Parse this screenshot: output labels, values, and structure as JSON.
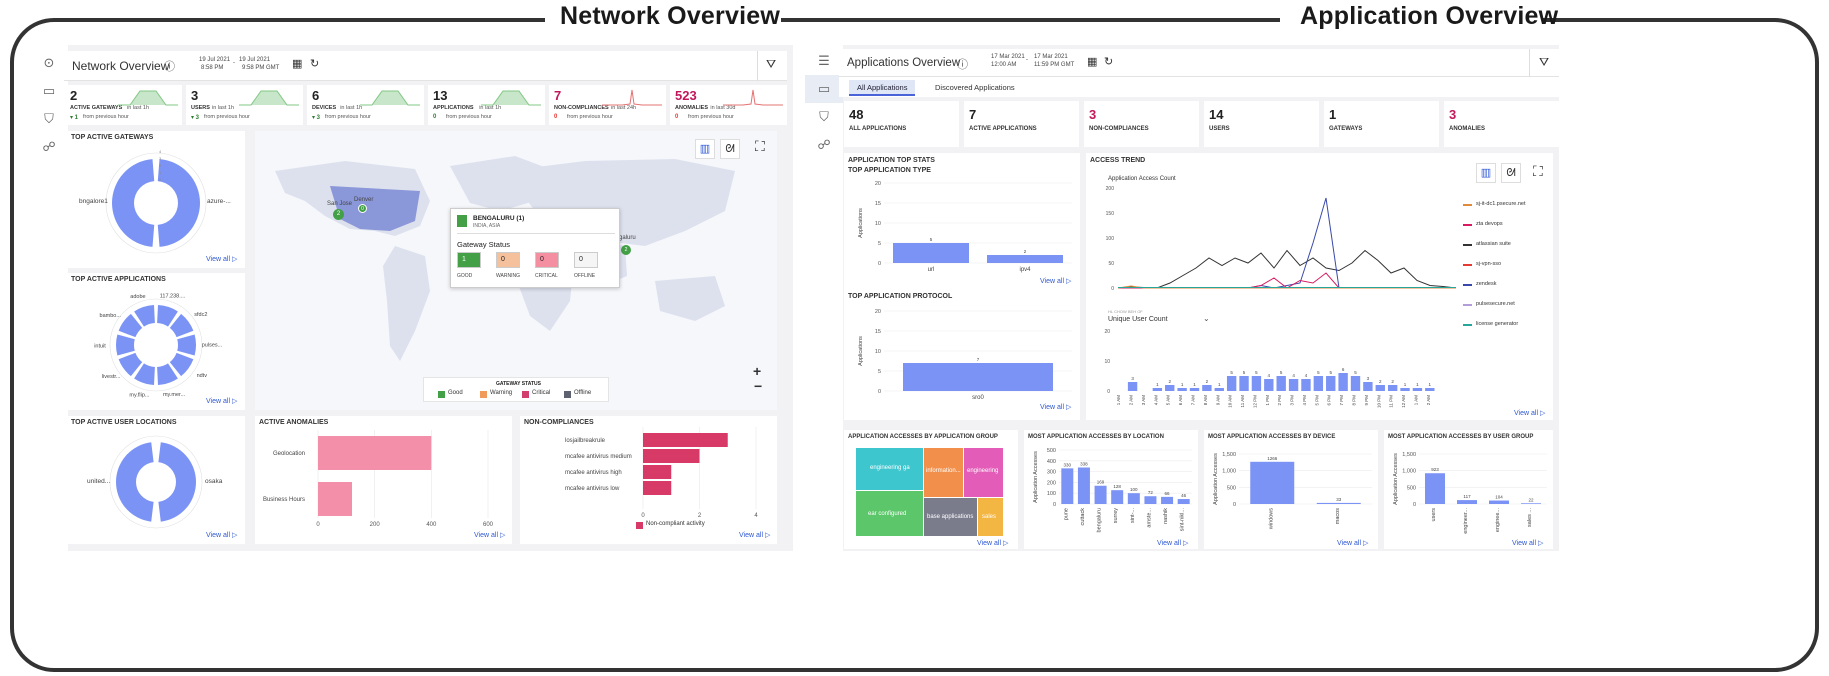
{
  "headers": {
    "network": "Network Overview",
    "application": "Application Overview"
  },
  "network": {
    "title": "Network Overview",
    "info_icon": "info-icon",
    "date_from": "19 Jul 2021",
    "time_from": "8:58 PM",
    "date_sep": "-",
    "date_to": "19 Jul 2021",
    "time_to": "9:58 PM GMT",
    "stats": [
      {
        "value": "2",
        "label": "ACTIVE GATEWAYS",
        "sub": "in last 1h",
        "delta": "▾ 1",
        "from": "from previous hour",
        "color": "#4caf50"
      },
      {
        "value": "3",
        "label": "USERS",
        "sub": "in last 1h",
        "delta": "▾ 3",
        "from": "from previous hour",
        "color": "#4caf50"
      },
      {
        "value": "6",
        "label": "DEVICES",
        "sub": "in last 1h",
        "delta": "▾ 3",
        "from": "from previous hour",
        "color": "#4caf50"
      },
      {
        "value": "13",
        "label": "APPLICATIONS",
        "sub": "in last 1h",
        "delta": "0",
        "from": "from previous hour",
        "color": "#4caf50"
      },
      {
        "value": "7",
        "label": "NON-COMPLIANCES",
        "sub": "in last 24h",
        "delta": "0",
        "from": "from previous hour",
        "color": "#e57373"
      },
      {
        "value": "523",
        "label": "ANOMALIES",
        "sub": "in last 30d",
        "delta": "0",
        "from": "from previous hour",
        "color": "#e57373"
      }
    ],
    "gateways": {
      "title": "TOP ACTIVE GATEWAYS",
      "labels": [
        "bngalore1",
        "azure-..."
      ],
      "ticks": [
        "4",
        "3",
        "2",
        "1",
        "0"
      ],
      "view_all": "View all ▷"
    },
    "apps": {
      "title": "TOP ACTIVE APPLICATIONS",
      "labels": [
        "117.238....",
        "sfdc2",
        "pulses...",
        "ndtv",
        "my.mer...",
        "my.flip...",
        "livestr...",
        "intuit",
        "bambo...",
        "adobe"
      ],
      "view_all": "View all ▷"
    },
    "locations": {
      "title": "TOP ACTIVE USER LOCATIONS",
      "labels": [
        "united...",
        "osaka"
      ],
      "view_all": "View all ▷"
    },
    "map": {
      "cities": [
        {
          "name": "San Jose",
          "count": "2"
        },
        {
          "name": "Denver",
          "count": "0"
        },
        {
          "name": "galuru",
          "count": "2"
        }
      ],
      "popup": {
        "title": "BENGALURU (1)",
        "region": "INDIA, ASIA",
        "status_title": "Gateway Status",
        "cells": [
          {
            "value": "1",
            "label": "GOOD"
          },
          {
            "value": "0",
            "label": "WARNING"
          },
          {
            "value": "0",
            "label": "CRITICAL"
          },
          {
            "value": "0",
            "label": "OFFLINE"
          }
        ]
      },
      "legend_title": "GATEWAY STATUS",
      "legend": [
        "Good",
        "Warning",
        "Critical",
        "Offline"
      ],
      "zoom_in": "+",
      "zoom_out": "−"
    },
    "anomalies": {
      "title": "ACTIVE ANOMALIES",
      "categories": [
        "Geolocation",
        "Business Hours"
      ],
      "values": [
        400,
        120
      ],
      "ticks": [
        "0",
        "200",
        "400",
        "600"
      ],
      "view_all": "View all ▷"
    },
    "noncomp": {
      "title": "NON-COMPLIANCES",
      "categories": [
        "losjailbreakrule",
        "mcafee antivirus medium",
        "mcafee antivirus high",
        "mcafee antivirus low"
      ],
      "values": [
        3,
        2,
        1,
        1
      ],
      "ticks": [
        "0",
        "2",
        "4"
      ],
      "legend": "Non-compliant activity",
      "view_all": "View all ▷"
    }
  },
  "application": {
    "title": "Applications Overview",
    "date_from": "17 Mar 2021",
    "time_from": "12:00 AM",
    "date_sep": "-",
    "date_to": "17 Mar 2021",
    "time_to": "11:59 PM GMT",
    "tabs": [
      "All Applications",
      "Discovered Applications"
    ],
    "stats": [
      {
        "value": "48",
        "label": "ALL APPLICATIONS",
        "red": false
      },
      {
        "value": "7",
        "label": "ACTIVE APPLICATIONS",
        "red": false
      },
      {
        "value": "3",
        "label": "NON-COMPLIANCES",
        "red": true
      },
      {
        "value": "14",
        "label": "USERS",
        "red": false
      },
      {
        "value": "1",
        "label": "GATEWAYS",
        "red": false
      },
      {
        "value": "3",
        "label": "ANOMALIES",
        "red": true
      }
    ],
    "topstats": {
      "title": "APPLICATION TOP STATS",
      "type_title": "TOP APPLICATION TYPE",
      "type_ylabel": "Applications",
      "type_cats": [
        "url",
        "ipv4"
      ],
      "type_vals": [
        5,
        2
      ],
      "type_ticks": [
        "20",
        "15",
        "10",
        "5",
        "0"
      ],
      "proto_title": "TOP APPLICATION PROTOCOL",
      "proto_ylabel": "Applications",
      "proto_cats": [
        "sro0"
      ],
      "proto_vals": [
        7
      ],
      "proto_ticks": [
        "20",
        "15",
        "10",
        "5",
        "0"
      ],
      "view_all": "View all ▷"
    },
    "access": {
      "title": "ACCESS TREND",
      "chart_title": "Application Access Count",
      "ticks": [
        "200",
        "150",
        "100",
        "50",
        "0"
      ],
      "legend": [
        "sj-it-dc1.psecure.net",
        "zta devops",
        "atlassian suite",
        "sj-vpn-sso",
        "zendesk",
        "pulsesecure.net",
        "license generator"
      ],
      "legend_colors": [
        "#e08a3c",
        "#d81b60",
        "#333333",
        "#e53935",
        "#3949ab",
        "#b39ddb",
        "#26a69a"
      ],
      "ucc_label": "Unique User Count",
      "ucc_small": "HL CHOW BEH OF",
      "bar_vals": [
        0,
        3,
        0,
        1,
        2,
        1,
        1,
        2,
        1,
        5,
        5,
        5,
        4,
        5,
        4,
        4,
        5,
        5,
        6,
        5,
        3,
        2,
        2,
        1,
        1,
        1
      ],
      "bar_ticks": [
        "20",
        "10",
        "0"
      ],
      "bar_labels": [
        "1 AM",
        "2 AM",
        "3 AM",
        "4 AM",
        "5 AM",
        "6 AM",
        "7 AM",
        "8 AM",
        "9 AM",
        "10 AM",
        "11 AM",
        "12 PM",
        "1 PM",
        "2 PM",
        "3 PM",
        "4 PM",
        "5 PM",
        "6 PM",
        "7 PM",
        "8 PM",
        "9 PM",
        "10 PM",
        "11 PM",
        "12 AM",
        "1 AM",
        "2 AM"
      ],
      "view_all": "View all ▷"
    },
    "group": {
      "title": "APPLICATION ACCESSES BY APPLICATION GROUP",
      "tiles": [
        "engineering ga",
        "information...",
        "engineering",
        "ear configured",
        "base applications",
        "sales"
      ],
      "view_all": "View all ▷"
    },
    "location": {
      "title": "MOST APPLICATION ACCESSES BY LOCATION",
      "ylabel": "Application Accesses",
      "ticks": [
        "500",
        "400",
        "300",
        "200",
        "100",
        "0"
      ],
      "cats": [
        "pune",
        "cuttack",
        "bengaluru",
        "surrey",
        "sint-...",
        "amste...",
        "nashik",
        "sint-nikl..."
      ],
      "vals": [
        330,
        338,
        169,
        128,
        100,
        72,
        66,
        46
      ],
      "view_all": "View all ▷"
    },
    "device": {
      "title": "MOST APPLICATION ACCESSES BY DEVICE",
      "ylabel": "Application Accesses",
      "ticks": [
        "1,500",
        "1,000",
        "500",
        "0"
      ],
      "cats": [
        "windows",
        "macos"
      ],
      "vals": [
        1266,
        33
      ],
      "view_all": "View all ▷"
    },
    "usergroup": {
      "title": "MOST APPLICATION ACCESSES BY USER GROUP",
      "ylabel": "Application Accesses",
      "ticks": [
        "1,500",
        "1,000",
        "500",
        "0"
      ],
      "cats": [
        "users",
        "engineer...",
        "enginee...",
        "sales ..."
      ],
      "vals": [
        923,
        117,
        104,
        22
      ],
      "view_all": "View all ▷"
    }
  }
}
